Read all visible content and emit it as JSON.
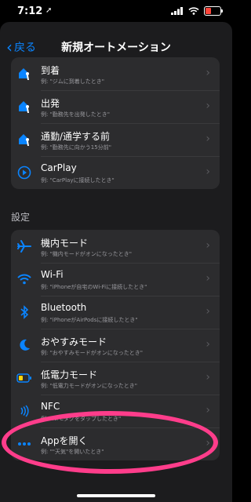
{
  "status": {
    "time": "7:12",
    "location_arrow": "➚"
  },
  "nav": {
    "back_label": "戻る",
    "title": "新規オートメーション"
  },
  "travel": [
    {
      "icon": "house-person-icon",
      "title": "到着",
      "subtitle": "例: \"ジムに到着したとき\""
    },
    {
      "icon": "house-person-icon",
      "title": "出発",
      "subtitle": "例: \"勤務先を出発したとき\""
    },
    {
      "icon": "house-person-icon",
      "title": "通勤/通学する前",
      "subtitle": "例: \"勤務先に向かう15分前\""
    },
    {
      "icon": "carplay-icon",
      "title": "CarPlay",
      "subtitle": "例: \"CarPlayに接続したとき\""
    }
  ],
  "settings_header": "設定",
  "settings": [
    {
      "icon": "airplane-icon",
      "title": "機内モード",
      "subtitle": "例: \"機内モードがオンになったとき\""
    },
    {
      "icon": "wifi-icon",
      "title": "Wi-Fi",
      "subtitle": "例: \"iPhoneが自宅のWi-Fiに接続したとき\""
    },
    {
      "icon": "bluetooth-icon",
      "title": "Bluetooth",
      "subtitle": "例: \"iPhoneがAirPodsに接続したとき\""
    },
    {
      "icon": "moon-icon",
      "title": "おやすみモード",
      "subtitle": "例: \"おやすみモードがオンになったとき\""
    },
    {
      "icon": "battery-icon",
      "title": "低電力モード",
      "subtitle": "例: \"低電力モードがオンになったとき\""
    },
    {
      "icon": "nfc-icon",
      "title": "NFC",
      "subtitle": "例: \"NFCタグをタップしたとき\""
    },
    {
      "icon": "app-icon",
      "title": "Appを開く",
      "subtitle": "例: \"\"天気\"を開いたとき\""
    }
  ],
  "colors": {
    "accent": "#0a84ff",
    "highlight": "#ff3d8b",
    "background": "#1c1c1e",
    "cell": "#2c2c2e"
  }
}
